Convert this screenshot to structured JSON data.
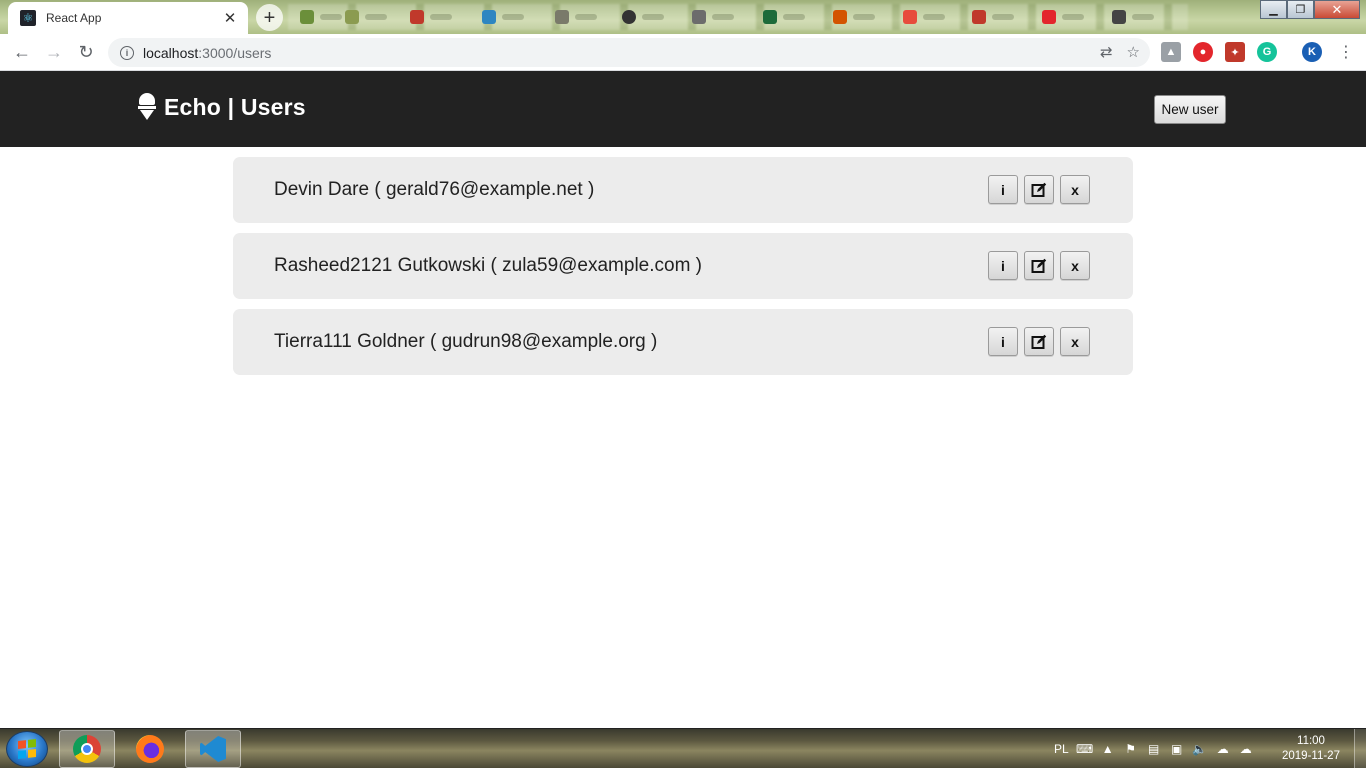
{
  "browser": {
    "tab_title": "React App",
    "tab_close": "✕",
    "new_tab": "+",
    "url_host": "localhost",
    "url_path": ":3000/users",
    "profile_initial": "K"
  },
  "app": {
    "title": "Echo | Users",
    "new_user_label": "New user",
    "header_bg": "#222222",
    "row_bg": "#ececec"
  },
  "users": [
    {
      "name": "Devin Dare",
      "email": "gerald76@example.net"
    },
    {
      "name": "Rasheed2121 Gutkowski",
      "email": "zula59@example.com"
    },
    {
      "name": "Tierra111 Goldner",
      "email": "gudrun98@example.org"
    }
  ],
  "row_actions": {
    "info": "i",
    "edit_icon": "edit-icon",
    "delete": "x"
  },
  "taskbar": {
    "language": "PL",
    "time": "11:00",
    "date": "2019-11-27"
  }
}
